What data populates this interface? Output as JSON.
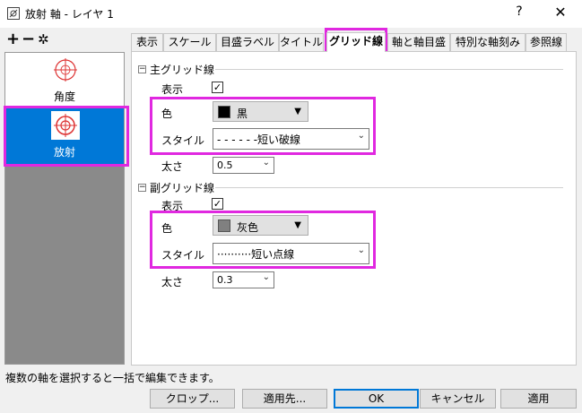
{
  "window": {
    "title": "放射 軸 - レイヤ 1",
    "help_label": "?",
    "close_label": "✕"
  },
  "toolbar": {
    "add_label": "+",
    "remove_label": "−",
    "settings_label": "✲"
  },
  "sidebar": {
    "items": [
      {
        "label": "角度",
        "icon": "polar-angle-icon"
      },
      {
        "label": "放射",
        "icon": "polar-radial-icon",
        "selected": true
      }
    ]
  },
  "tabs": [
    {
      "label": "表示"
    },
    {
      "label": "スケール"
    },
    {
      "label": "目盛ラベル"
    },
    {
      "label": "タイトル"
    },
    {
      "label": "グリッド線",
      "active": true
    },
    {
      "label": "軸と軸目盛"
    },
    {
      "label": "特別な軸刻み"
    },
    {
      "label": "参照線"
    }
  ],
  "major": {
    "section_title": "主グリッド線",
    "toggle": "−",
    "show_label": "表示",
    "show_checked": "✓",
    "color_label": "色",
    "color_value": "黒",
    "color_hex": "#000000",
    "style_label": "スタイル",
    "style_value": "- - - - - -短い破線",
    "thickness_label": "太さ",
    "thickness_value": "0.5"
  },
  "minor": {
    "section_title": "副グリッド線",
    "toggle": "−",
    "show_label": "表示",
    "show_checked": "✓",
    "color_label": "色",
    "color_value": "灰色",
    "color_hex": "#808080",
    "style_label": "スタイル",
    "style_value": "··········短い点線",
    "thickness_label": "太さ",
    "thickness_value": "0.3"
  },
  "status_text": "複数の軸を選択すると一括で編集できます。",
  "buttons": {
    "crop": "クロップ...",
    "apply_to": "適用先...",
    "ok": "OK",
    "cancel": "キャンセル",
    "apply": "適用"
  },
  "colors": {
    "highlight": "#e028e0",
    "selected": "#0078d7"
  }
}
